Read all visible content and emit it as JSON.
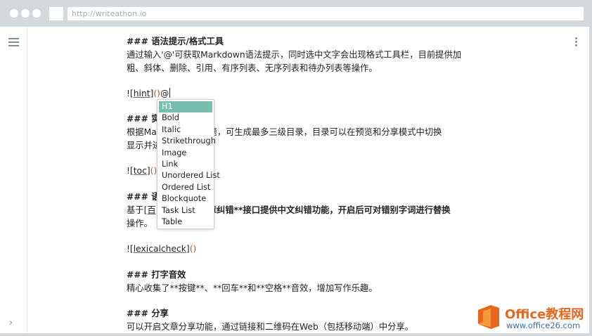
{
  "browser": {
    "url": "http://writeathon.io"
  },
  "editor": {
    "lines": {
      "l1": "### 语法提示/格式工具",
      "l2": "通过输入'@'可获取Markdown语法提示，同时选中文字会出现格式工具栏，目前提供加",
      "l3": "粗、斜体、删除、引用、有序列表、无序列表和待办列表等操作。",
      "l4_prefix": "![",
      "l4_link": "hint",
      "l4_mid": "]",
      "l4_paren": "()",
      "l4_at": "@",
      "l5": "### 实",
      "l6a": "根据Mar",
      "l6b": "的标题，可生成最多三级目录，目录可以在预览和分享模式中切换",
      "l7": "显示并进",
      "l8_prefix": "![",
      "l8_link": "toc",
      "l8_mid": "]",
      "l8_paren": "()",
      "l9": "### 语",
      "l10a": "基于[",
      "l10b": "百",
      "l10c": "章纠错**接口提供中文纠错功能，开启后可对错别字词进行替换",
      "l11": "操作。",
      "l12_prefix": "![",
      "l12_link": "lexicalcheck",
      "l12_mid": "]",
      "l12_paren": "()",
      "l13": "### 打字音效",
      "l14": "精心收集了**按键**、**回车**和**空格**音效，增加写作乐趣。",
      "l15": "### 分享",
      "l16": "可以开启文章分享功能，通过链接和二维码在Web（包括移动端）中分享。"
    }
  },
  "autocomplete": {
    "items": [
      "H1",
      "Bold",
      "Italic",
      "Strikethrough",
      "Image",
      "Link",
      "Unordered List",
      "Ordered List",
      "Blockquote",
      "Task List",
      "Table"
    ],
    "active_index": 0
  },
  "watermark": {
    "title": "Office教程网",
    "url": "www.office26.com"
  },
  "colors": {
    "accent": "#78bfae",
    "paren": "#b35c1e",
    "watermark_orange": "#e8651d",
    "watermark_blue": "#3a6cb4"
  }
}
